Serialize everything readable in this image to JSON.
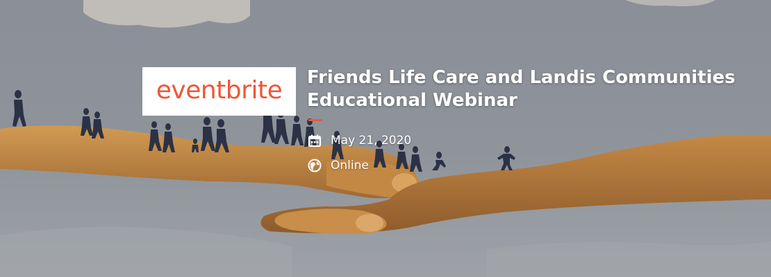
{
  "banner": {
    "logo_text": "eventbrite",
    "title": "Friends Life Care and Landis Communities Educational Webinar",
    "date": "May 21, 2020",
    "location": "Online"
  },
  "icons": {
    "date": "calendar-icon",
    "location": "globe-icon"
  },
  "colors": {
    "brand_orange": "#f05537",
    "accent_orange": "#f05537",
    "text": "#ffffff",
    "sky": "#8c9199",
    "hand_primary": "#b47b3c",
    "hand_secondary": "#d49a4f",
    "figures": "#2c3245"
  }
}
